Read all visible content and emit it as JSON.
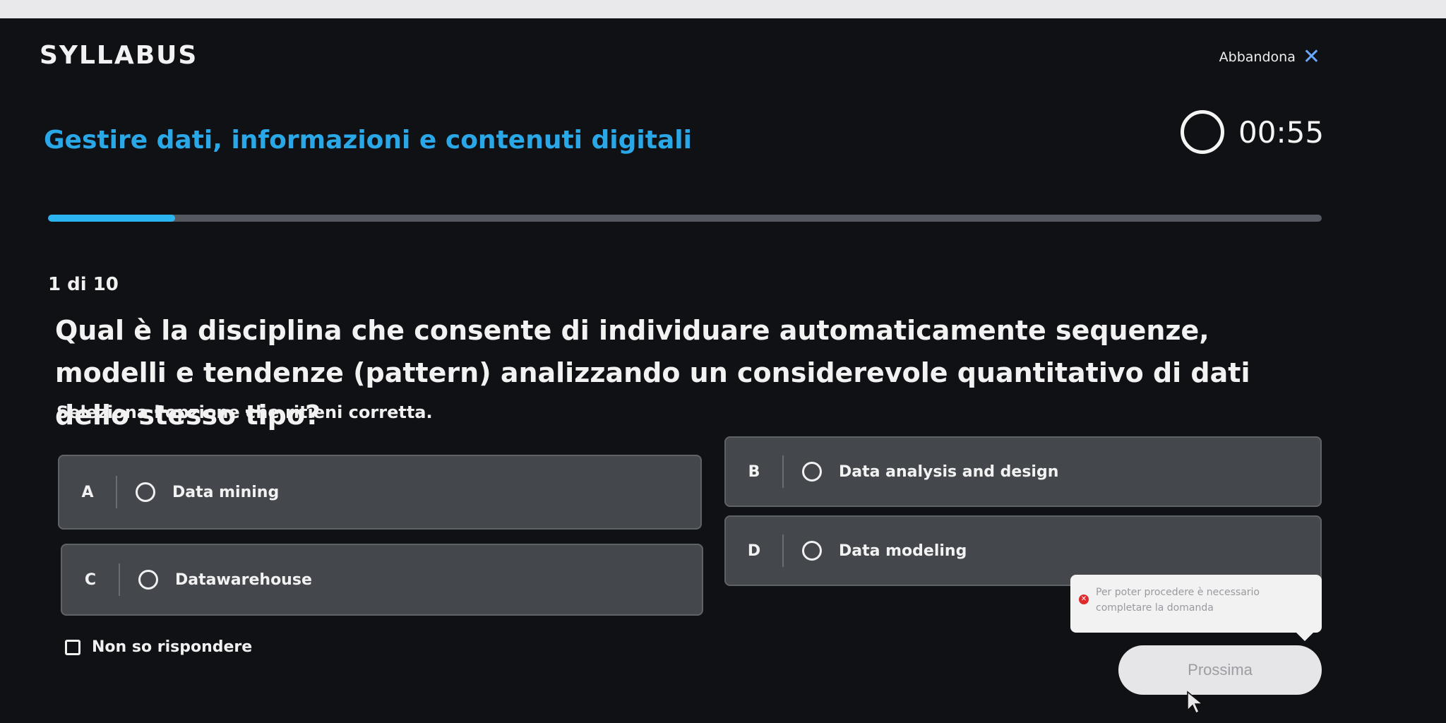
{
  "header": {
    "logo_text": "SYLLABUS",
    "abandon_label": "Abbandona",
    "abandon_icon": "close-icon"
  },
  "course": {
    "title": "Gestire dati, informazioni e contenuti digitali"
  },
  "timer": {
    "value": "00:55",
    "icon": "timer-ring-icon"
  },
  "progress": {
    "current": 1,
    "total": 10,
    "fraction": 0.1,
    "label": "1 di 10",
    "fill_color": "#2bb4f0"
  },
  "question": {
    "text": "Qual è la disciplina che consente di individuare automaticamente sequenze, modelli e tendenze (pattern) analizzando un considerevole quantitativo di dati dello stesso tipo?",
    "instruction": "Seleziona l'opzione che ritieni corretta."
  },
  "options": [
    {
      "letter": "A",
      "label": "Data mining"
    },
    {
      "letter": "B",
      "label": "Data analysis and design"
    },
    {
      "letter": "C",
      "label": "Datawarehouse"
    },
    {
      "letter": "D",
      "label": "Data modeling"
    }
  ],
  "tooltip": {
    "message": "Per poter procedere è necessario completare la domanda",
    "icon": "error-icon"
  },
  "dont_know": {
    "label": "Non so rispondere",
    "checked": false
  },
  "next_button": {
    "label": "Prossima"
  },
  "colors": {
    "background": "#101114",
    "accent": "#2aa7e6",
    "option_bg": "#44474c"
  }
}
